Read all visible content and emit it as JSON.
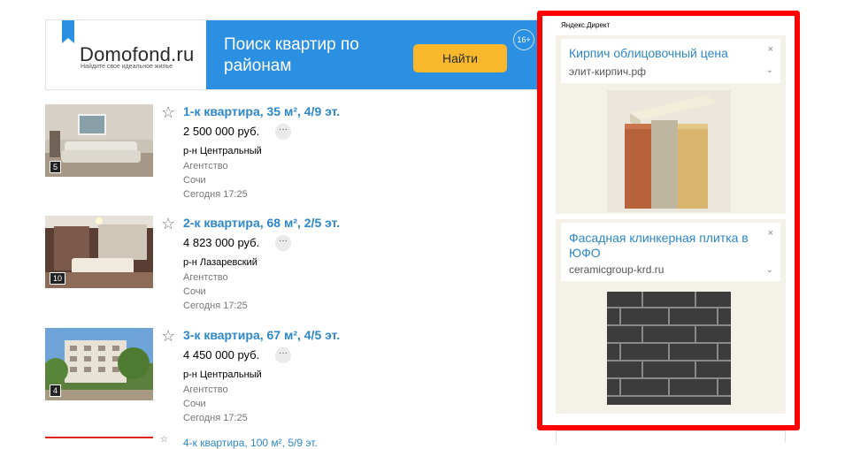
{
  "banner": {
    "logo": "Domofond.ru",
    "logo_sub": "Найдите свое идеальное жилье",
    "title": "Поиск квартир по районам",
    "button": "Найти",
    "age": "16+",
    "colors": {
      "bg": "#2b8fe2",
      "button": "#f7b92b"
    }
  },
  "listings": [
    {
      "title": "1-к квартира, 35 м², 4/9 эт.",
      "price": "2 500 000 руб.",
      "district": "р-н Центральный",
      "agency": "Агентство",
      "city": "Сочи",
      "time": "Сегодня 17:25",
      "photos": "5"
    },
    {
      "title": "2-к квартира, 68 м², 2/5 эт.",
      "price": "4 823 000 руб.",
      "district": "р-н Лазаревский",
      "agency": "Агентство",
      "city": "Сочи",
      "time": "Сегодня 17:25",
      "photos": "10"
    },
    {
      "title": "3-к квартира, 67 м², 4/5 эт.",
      "price": "4 450 000 руб.",
      "district": "р-н Центральный",
      "agency": "Агентство",
      "city": "Сочи",
      "time": "Сегодня 17:25",
      "photos": "4"
    }
  ],
  "partial_listing": {
    "title": "4-к квартира, 100 м², 5/9 эт."
  },
  "more_icon": "···",
  "star_icon": "☆",
  "ads": {
    "label": "Яндекс.Директ",
    "items": [
      {
        "title": "Кирпич облицовочный цена",
        "url": "элит-кирпич.рф",
        "close": "×",
        "chevron": "⌄"
      },
      {
        "title": "Фасадная клинкерная плитка в ЮФО",
        "url": "ceramicgroup-krd.ru",
        "close": "×",
        "chevron": "⌄"
      }
    ],
    "frame_color": "#ff0000"
  }
}
